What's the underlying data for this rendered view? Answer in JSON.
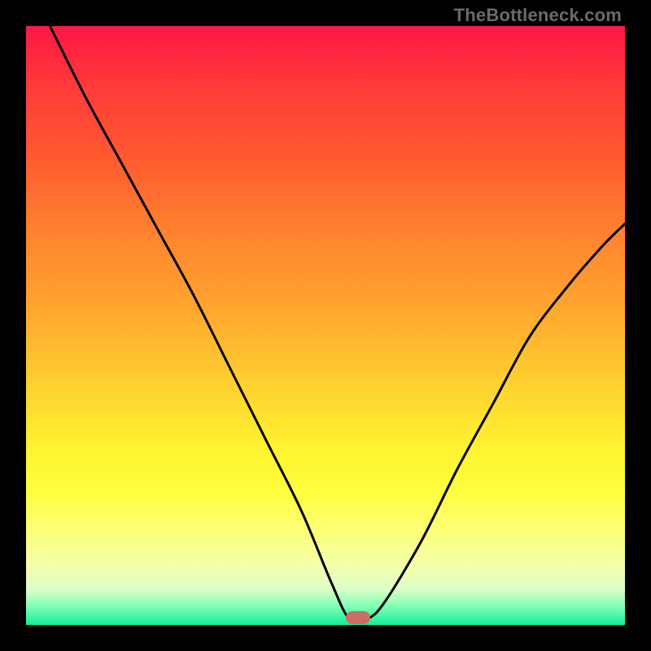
{
  "attribution": "TheBottleneck.com",
  "marker": {
    "x_frac": 0.555,
    "y_frac": 0.988,
    "color": "#cc6d68"
  },
  "chart_data": {
    "type": "line",
    "title": "",
    "xlabel": "",
    "ylabel": "",
    "xlim": [
      0,
      100
    ],
    "ylim": [
      0,
      100
    ],
    "grid": false,
    "legend": false,
    "series": [
      {
        "name": "curve",
        "x": [
          4,
          10,
          16,
          22,
          28,
          34,
          40,
          46,
          51,
          54,
          57,
          60,
          66,
          72,
          78,
          84,
          90,
          96,
          100
        ],
        "y": [
          100,
          88,
          77,
          66,
          55,
          43,
          31,
          19,
          7,
          1,
          1,
          4,
          14,
          26,
          37,
          48,
          56,
          63,
          67
        ]
      }
    ],
    "background_gradient": {
      "direction": "vertical",
      "stops": [
        {
          "pos": 0.0,
          "color": "#ff1744"
        },
        {
          "pos": 0.5,
          "color": "#ffbf2f"
        },
        {
          "pos": 0.8,
          "color": "#fff94e"
        },
        {
          "pos": 1.0,
          "color": "#11ee98"
        }
      ]
    },
    "marker_point": {
      "x": 55.5,
      "y": 1.2
    }
  }
}
